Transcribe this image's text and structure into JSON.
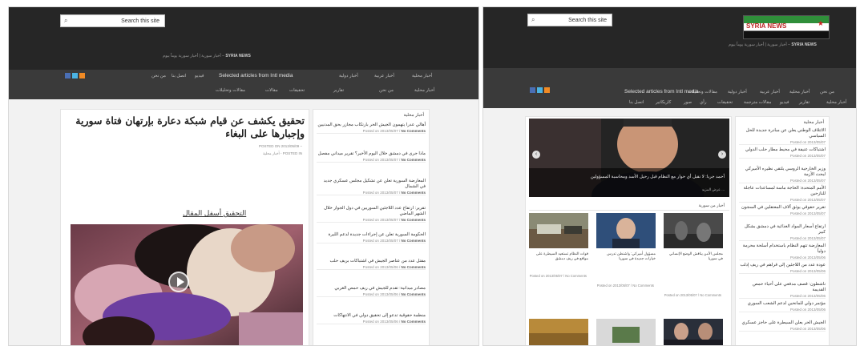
{
  "left": {
    "search_placeholder": "Search this site",
    "tagline_prefix": "أخبار سورية | أخبار سورية يوماً بيوم –",
    "tagline_site": "SYRIA NEWS",
    "nav_row1": [
      "أخبار محلية",
      "أخبار عربية",
      "أخبار دولية",
      "Selected articles from Intl media",
      "فيديو",
      "اتصل بنا",
      "من نحن"
    ],
    "nav_row2": [
      "أخبار محلية",
      "من نحن",
      "تقارير",
      "تحقيقات",
      "مقالات",
      "مقالات وتحليلات"
    ],
    "article_title": "تحقيق يكشف عن قيام شبكة دعارة بإرتهان فتاة سورية وإجبارها على البغاء",
    "posted_on": "POSTED ON 2013/05/09 –",
    "posted_in": "أخبار محلية",
    "posted_in_label": "POSTED IN",
    "video_caption": "التحقيق أسفل المقال",
    "sidebar_title": "أخبار محلية",
    "sidebar_items": [
      {
        "title": "أهالي عدرا يتهمون الجيش الحر بارتكاب مجازر بحق المدنيين",
        "date": "Posted on 2013/05/07",
        "comments": "No Comments"
      },
      {
        "title": "ماذا جرى في دمشق خلال اليوم الأخير؟ تقرير ميداني مفصل",
        "date": "Posted on 2013/05/07",
        "comments": "No Comments"
      },
      {
        "title": "المعارضة السورية تعلن عن تشكيل مجلس عسكري جديد في الشمال",
        "date": "Posted on 2013/05/07",
        "comments": "No Comments"
      },
      {
        "title": "تقرير: ارتفاع عدد اللاجئين السوريين في دول الجوار خلال الشهر الماضي",
        "date": "Posted on 2013/05/07",
        "comments": "No Comments"
      },
      {
        "title": "الحكومة السورية تعلن عن إجراءات جديدة لدعم الليرة",
        "date": "Posted on 2013/05/07",
        "comments": "No Comments"
      },
      {
        "title": "مقتل عدد من عناصر الجيش في اشتباكات بريف حلب",
        "date": "Posted on 2013/05/06",
        "comments": "No Comments"
      },
      {
        "title": "مصادر ميدانية: تقدم للجيش في ريف حمص الغربي",
        "date": "Posted on 2013/05/06",
        "comments": "No Comments"
      },
      {
        "title": "منظمة حقوقية تدعو إلى تحقيق دولي في الانتهاكات",
        "date": "Posted on 2013/05/06",
        "comments": "No Comments"
      }
    ]
  },
  "right": {
    "search_placeholder": "Search this site",
    "tagline_prefix": "أخبار سورية | أخبار سورية يوماً بيوم –",
    "tagline_site": "SYRIA NEWS",
    "logo_text": "SYRIA NEWS",
    "nav_row1": [
      "من نحن",
      "أخبار محلية",
      "أخبار عربية",
      "أخبار دولية",
      "مقالات وتحليلات",
      "Selected articles from Intl media"
    ],
    "nav_row2": [
      "أخبار محلية",
      "تقارير",
      "فيديو",
      "مقالات مترجمة",
      "تحقيقات",
      "رأي",
      "صور",
      "كاريكاتير",
      "اتصل بنا"
    ],
    "featured_caption": "أحمد جربا: لا نقبل أي حوار مع النظام قبل رحيل الأسد ومحاسبة المسؤولين",
    "featured_meta": "عرض المزيد ...",
    "section_title": "أخبار من سورية",
    "sidebar_title": "أخبار محلية",
    "cards": [
      {
        "title": "قوات النظام تستعيد السيطرة على مواقع في ريف دمشق",
        "meta": "Posted on 2013/05/07 / No Comments"
      },
      {
        "title": "مسؤول أميركي: واشنطن تدرس خيارات جديدة في سوريا",
        "meta": "Posted on 2013/05/07 / No Comments"
      },
      {
        "title": "مجلس الأمن يناقش الوضع الإنساني في سوريا",
        "meta": "Posted on 2013/05/07 / No Comments"
      }
    ],
    "sidebar_items": [
      {
        "title": "الائتلاف الوطني يعلن عن مبادرة جديدة للحل السياسي",
        "date": "Posted on 2013/05/07"
      },
      {
        "title": "اشتباكات عنيفة في محيط مطار حلب الدولي",
        "date": "Posted on 2013/05/07"
      },
      {
        "title": "وزير الخارجية الروسي يلتقي نظيره الأميركي لبحث الأزمة",
        "date": "Posted on 2013/05/07"
      },
      {
        "title": "الأمم المتحدة: الحاجة ماسة لمساعدات عاجلة للنازحين",
        "date": "Posted on 2013/05/07"
      },
      {
        "title": "تقرير حقوقي يوثق آلاف المعتقلين في السجون",
        "date": "Posted on 2013/05/07"
      },
      {
        "title": "ارتفاع أسعار المواد الغذائية في دمشق بشكل كبير",
        "date": "Posted on 2013/05/07"
      },
      {
        "title": "المعارضة تتهم النظام باستخدام أسلحة محرمة دولياً",
        "date": "Posted on 2013/05/06"
      },
      {
        "title": "عودة عدد من اللاجئين إلى قراهم في ريف إدلب",
        "date": "Posted on 2013/05/06"
      },
      {
        "title": "ناشطون: قصف مدفعي على أحياء حمص القديمة",
        "date": "Posted on 2013/05/06"
      },
      {
        "title": "مؤتمر دولي للمانحين لدعم الشعب السوري",
        "date": "Posted on 2013/05/06"
      },
      {
        "title": "الجيش الحر يعلن السيطرة على حاجز عسكري",
        "date": "Posted on 2013/05/06"
      }
    ]
  }
}
